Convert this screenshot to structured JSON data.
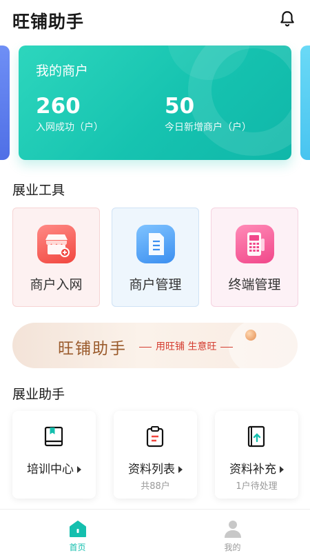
{
  "header": {
    "title": "旺铺助手"
  },
  "merchant_card": {
    "title": "我的商户",
    "stats": [
      {
        "value": "260",
        "label": "入网成功（户）"
      },
      {
        "value": "50",
        "label": "今日新增商户（户）"
      }
    ]
  },
  "tools_section": {
    "title": "展业工具",
    "items": [
      {
        "label": "商户入网",
        "icon": "store-icon"
      },
      {
        "label": "商户管理",
        "icon": "document-icon"
      },
      {
        "label": "终端管理",
        "icon": "pos-terminal-icon"
      }
    ]
  },
  "banner": {
    "title": "旺铺助手",
    "subtitle": "用旺铺  生意旺"
  },
  "helper_section": {
    "title": "展业助手",
    "items": [
      {
        "label": "培训中心",
        "sub": "",
        "icon": "book-icon"
      },
      {
        "label": "资料列表",
        "sub": "共88户",
        "icon": "clipboard-icon"
      },
      {
        "label": "资料补充",
        "sub": "1户待处理",
        "icon": "upload-doc-icon"
      }
    ]
  },
  "tabbar": {
    "items": [
      {
        "label": "首页",
        "icon": "home-icon",
        "active": true
      },
      {
        "label": "我的",
        "icon": "user-icon",
        "active": false
      }
    ]
  },
  "colors": {
    "accent": "#14bfae",
    "red": "#f1473f",
    "blue": "#3c8ff0",
    "pink": "#f1478a"
  }
}
